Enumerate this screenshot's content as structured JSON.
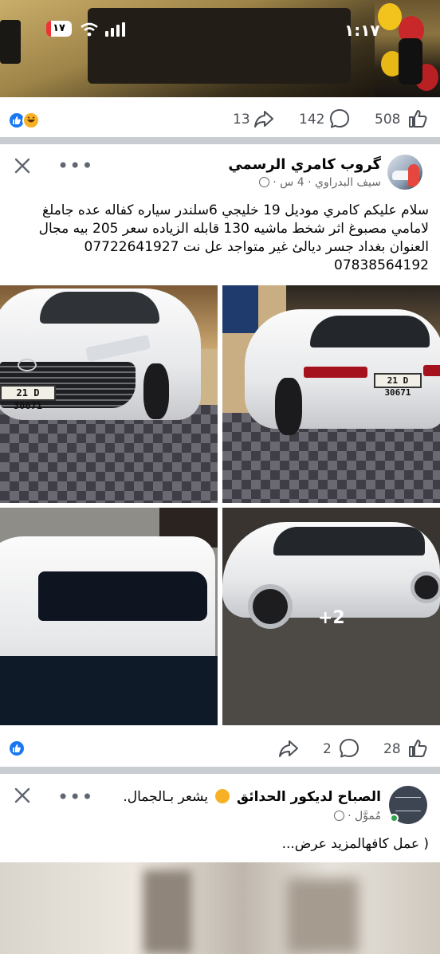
{
  "status_bar": {
    "time": "١:١٧",
    "battery": "١٧"
  },
  "post1_bar": {
    "reaction_count": "",
    "shares": "13",
    "comments": "142",
    "likes": "508"
  },
  "post2": {
    "group_name": "گروب كامري الرسمي",
    "author": "سيف البدراوي",
    "time": "4 س",
    "text": "سلام عليكم كامري موديل 19 خليجي 6سلندر سياره كفاله عده جاملغ لامامي مصبوغ اثر شخط ماشيه 130 قابله الزياده سعر 205 بيه مجال العنوان بغداد جسر ديالئ  غير متواجد عل نت 07722641927 07838564192",
    "plate_front": "21 D 30671",
    "plate_rear": "21 D 30671",
    "more_photos": "+2",
    "shares": "",
    "comments": "2",
    "likes": "28"
  },
  "post3": {
    "page_name": "الصباح لديكور الحدائق",
    "feeling": "يشعر بـالجمال.",
    "sponsored": "مُموَّل",
    "text": "( عمل كافهالمزيد عرض..."
  },
  "colors": {
    "accent": "#1877f2",
    "divider": "#c9ccd1",
    "text_secondary": "#65676b"
  },
  "icons": [
    "signal-icon",
    "wifi-icon",
    "battery-icon",
    "like-icon",
    "haha-icon",
    "share-icon",
    "comment-icon",
    "close-icon",
    "more-icon",
    "globe-icon"
  ]
}
